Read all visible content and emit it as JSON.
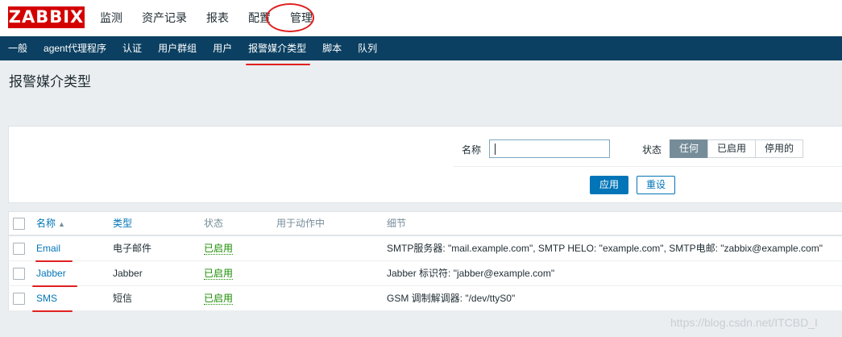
{
  "header": {
    "logo": "ZABBIX",
    "menu": [
      {
        "label": "监测"
      },
      {
        "label": "资产记录"
      },
      {
        "label": "报表"
      },
      {
        "label": "配置"
      },
      {
        "label": "管理"
      }
    ]
  },
  "subnav": [
    {
      "label": "一般"
    },
    {
      "label": "agent代理程序"
    },
    {
      "label": "认证"
    },
    {
      "label": "用户群组"
    },
    {
      "label": "用户"
    },
    {
      "label": "报警媒介类型"
    },
    {
      "label": "脚本"
    },
    {
      "label": "队列"
    }
  ],
  "page": {
    "title": "报警媒介类型"
  },
  "filter": {
    "name_label": "名称",
    "name_value": "",
    "status_label": "状态",
    "status_options": [
      "任何",
      "已启用",
      "停用的"
    ],
    "status_selected": "任何",
    "apply_label": "应用",
    "reset_label": "重设"
  },
  "table": {
    "headers": {
      "name": "名称",
      "type": "类型",
      "status": "状态",
      "used_in_actions": "用于动作中",
      "details": "细节"
    },
    "rows": [
      {
        "name": "Email",
        "type": "电子邮件",
        "status": "已启用",
        "used": "",
        "details": "SMTP服务器: \"mail.example.com\", SMTP HELO: \"example.com\", SMTP电邮: \"zabbix@example.com\""
      },
      {
        "name": "Jabber",
        "type": "Jabber",
        "status": "已启用",
        "used": "",
        "details": "Jabber 标识符: \"jabber@example.com\""
      },
      {
        "name": "SMS",
        "type": "短信",
        "status": "已启用",
        "used": "",
        "details": "GSM 调制解调器: \"/dev/ttyS0\""
      }
    ]
  },
  "watermark": "https://blog.csdn.net/ITCBD_I",
  "colors": {
    "nav_bg": "#0b4062",
    "logo_bg": "#d40000",
    "link": "#0275b8",
    "enabled": "#1a8c00",
    "annotation": "#e02020"
  }
}
